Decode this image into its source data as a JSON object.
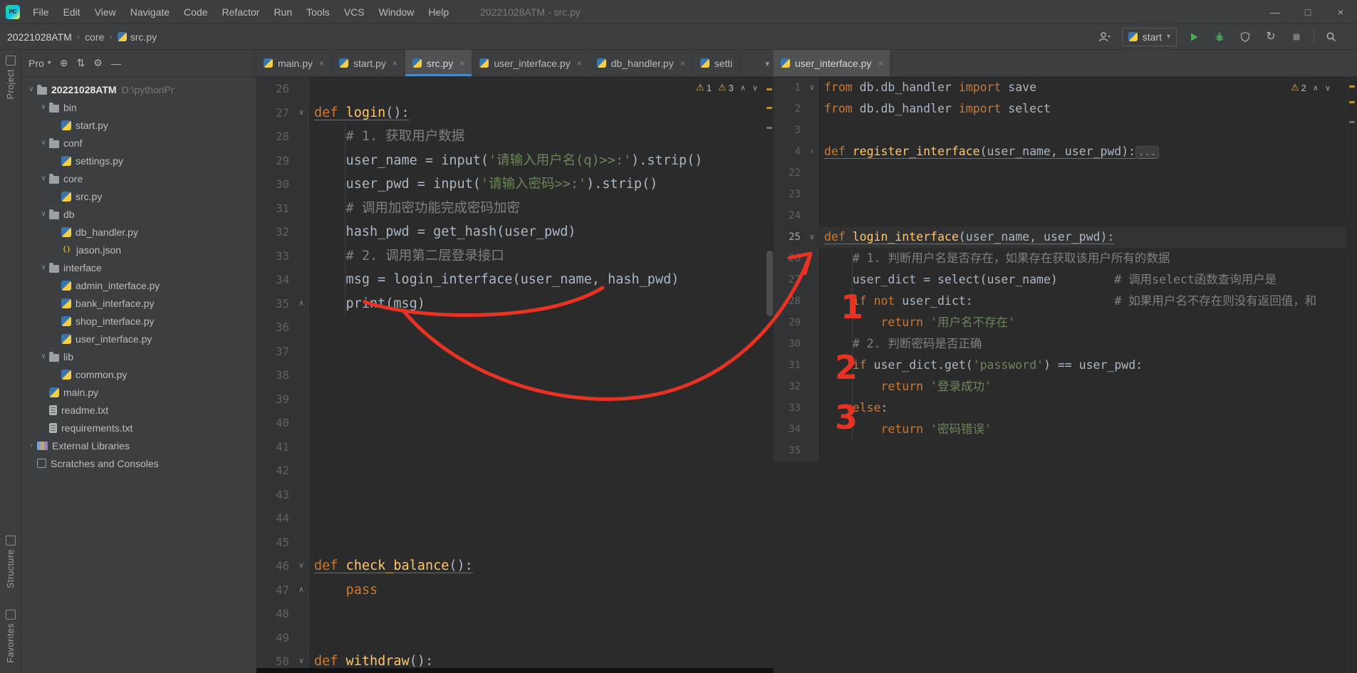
{
  "icons": {
    "close": "×",
    "chevron_down": "▾",
    "breadcrumb_sep": "›",
    "warning": "⚠",
    "collapse": "∧",
    "expand": "∨",
    "minimize": "—",
    "maximize": "□",
    "close_window": "×",
    "locate": "⊕",
    "swap": "⇅",
    "gear": "⚙",
    "hide": "—",
    "restart": "↻",
    "json_braces": "{}",
    "fold_open": "∨",
    "fold_end": "∧",
    "fold_closed": "›"
  },
  "title_bar": {
    "title": "20221028ATM - src.py",
    "menu": [
      "File",
      "Edit",
      "View",
      "Navigate",
      "Code",
      "Refactor",
      "Run",
      "Tools",
      "VCS",
      "Window",
      "Help"
    ]
  },
  "toolbar": {
    "breadcrumbs": [
      "20221028ATM",
      "core",
      "src.py"
    ],
    "run_config": "start"
  },
  "left_stripe": {
    "top": "Project",
    "bottom": [
      "Structure",
      "Favorites"
    ]
  },
  "project_panel": {
    "title": "Pro",
    "tree": [
      {
        "label": "20221028ATM",
        "suffix": "D:\\pythonPr",
        "type": "root",
        "level": 0,
        "chev": "v",
        "bold": true
      },
      {
        "label": "bin",
        "type": "folder",
        "level": 1,
        "chev": "v"
      },
      {
        "label": "start.py",
        "type": "py",
        "level": 2
      },
      {
        "label": "conf",
        "type": "folder",
        "level": 1,
        "chev": "v"
      },
      {
        "label": "settings.py",
        "type": "py",
        "level": 2
      },
      {
        "label": "core",
        "type": "folder",
        "level": 1,
        "chev": "v"
      },
      {
        "label": "src.py",
        "type": "py",
        "level": 2
      },
      {
        "label": "db",
        "type": "folder",
        "level": 1,
        "chev": "v"
      },
      {
        "label": "db_handler.py",
        "type": "py",
        "level": 2
      },
      {
        "label": "jason.json",
        "type": "json",
        "level": 2
      },
      {
        "label": "interface",
        "type": "folder",
        "level": 1,
        "chev": "v"
      },
      {
        "label": "admin_interface.py",
        "type": "py",
        "level": 2
      },
      {
        "label": "bank_interface.py",
        "type": "py",
        "level": 2
      },
      {
        "label": "shop_interface.py",
        "type": "py",
        "level": 2
      },
      {
        "label": "user_interface.py",
        "type": "py",
        "level": 2
      },
      {
        "label": "lib",
        "type": "folder",
        "level": 1,
        "chev": "v"
      },
      {
        "label": "common.py",
        "type": "py",
        "level": 2
      },
      {
        "label": "main.py",
        "type": "py",
        "level": 1
      },
      {
        "label": "readme.txt",
        "type": "txt",
        "level": 1
      },
      {
        "label": "requirements.txt",
        "type": "txt",
        "level": 1
      },
      {
        "label": "External Libraries",
        "type": "ext",
        "level": 0,
        "chev": ">"
      },
      {
        "label": "Scratches and Consoles",
        "type": "scratch",
        "level": 0
      }
    ]
  },
  "tabs": {
    "left": [
      {
        "label": "main.py"
      },
      {
        "label": "start.py"
      },
      {
        "label": "src.py",
        "active": "blue"
      },
      {
        "label": "user_interface.py"
      },
      {
        "label": "db_handler.py"
      },
      {
        "label": "setti",
        "close": false
      }
    ],
    "right": [
      {
        "label": "user_interface.py",
        "active": "gray"
      }
    ]
  },
  "editor_left": {
    "warnings": [
      "1",
      "3"
    ],
    "lines": [
      {
        "n": 26
      },
      {
        "n": 27,
        "f": "∨",
        "u": true,
        "t": [
          [
            "kw",
            "def"
          ],
          [
            "fn",
            " login"
          ],
          [
            "pl",
            "():"
          ]
        ]
      },
      {
        "n": 28,
        "t": [
          [
            "cm",
            "    # 1. 获取用户数据"
          ]
        ]
      },
      {
        "n": 29,
        "t": [
          [
            "pl",
            "    user_name = input("
          ],
          [
            "st",
            "'请输入用户名(q)>>:'"
          ],
          [
            "pl",
            ").strip()"
          ]
        ]
      },
      {
        "n": 30,
        "t": [
          [
            "pl",
            "    user_pwd = input("
          ],
          [
            "st",
            "'请输入密码>>:'"
          ],
          [
            "pl",
            ").strip()"
          ]
        ]
      },
      {
        "n": 31,
        "t": [
          [
            "cm",
            "    # 调用加密功能完成密码加密"
          ]
        ]
      },
      {
        "n": 32,
        "t": [
          [
            "pl",
            "    hash_pwd = get_hash(user_pwd)"
          ]
        ]
      },
      {
        "n": 33,
        "t": [
          [
            "cm",
            "    # 2. 调用第二层登录接口"
          ]
        ]
      },
      {
        "n": 34,
        "t": [
          [
            "pl",
            "    msg = login_interface(user_name, hash_pwd)"
          ]
        ]
      },
      {
        "n": 35,
        "f": "∧",
        "t": [
          [
            "pl",
            "    print(msg)"
          ]
        ]
      },
      {
        "n": 36
      },
      {
        "n": 37
      },
      {
        "n": 38
      },
      {
        "n": 39
      },
      {
        "n": 40
      },
      {
        "n": 41
      },
      {
        "n": 42
      },
      {
        "n": 43
      },
      {
        "n": 44
      },
      {
        "n": 45
      },
      {
        "n": 46,
        "f": "∨",
        "u": true,
        "t": [
          [
            "kw",
            "def"
          ],
          [
            "fn",
            " check_balance"
          ],
          [
            "pl",
            "():"
          ]
        ]
      },
      {
        "n": 47,
        "f": "∧",
        "t": [
          [
            "kw",
            "    pass"
          ]
        ]
      },
      {
        "n": 48
      },
      {
        "n": 49
      },
      {
        "n": 50,
        "f": "∨",
        "u": true,
        "t": [
          [
            "kw",
            "def"
          ],
          [
            "fn",
            " withdraw"
          ],
          [
            "pl",
            "():"
          ]
        ]
      }
    ]
  },
  "editor_right": {
    "warnings": [
      "2"
    ],
    "lines": [
      {
        "n": 1,
        "f": "∨",
        "t": [
          [
            "kw",
            "from"
          ],
          [
            "pl",
            " db.db_handler "
          ],
          [
            "kw",
            "import"
          ],
          [
            "pl",
            " save"
          ]
        ]
      },
      {
        "n": 2,
        "t": [
          [
            "kw",
            "from"
          ],
          [
            "pl",
            " db.db_handler "
          ],
          [
            "kw",
            "import"
          ],
          [
            "pl",
            " select"
          ]
        ]
      },
      {
        "n": 3
      },
      {
        "n": 4,
        "f": "›",
        "u": true,
        "t": [
          [
            "kw",
            "def"
          ],
          [
            "fn",
            " register_interface"
          ],
          [
            "pl",
            "(user_name, user_pwd):"
          ],
          [
            "fd",
            "..."
          ]
        ]
      },
      {
        "n": 22
      },
      {
        "n": 23
      },
      {
        "n": 24
      },
      {
        "n": 25,
        "f": "∨",
        "u": true,
        "h": true,
        "t": [
          [
            "kw",
            "def"
          ],
          [
            "fn",
            " login_interface"
          ],
          [
            "pl",
            "(user_name, user_pwd):"
          ]
        ]
      },
      {
        "n": 26,
        "t": [
          [
            "cm",
            "    # 1. 判断用户名是否存在，如果存在获取该用户所有的数据"
          ]
        ]
      },
      {
        "n": 27,
        "t": [
          [
            "pl",
            "    user_dict = select(user_name)        "
          ],
          [
            "cm",
            "# 调用select函数查询用户是"
          ]
        ]
      },
      {
        "n": 28,
        "t": [
          [
            "pl",
            "    "
          ],
          [
            "kw",
            "if"
          ],
          [
            "pl",
            " "
          ],
          [
            "kw",
            "not"
          ],
          [
            "pl",
            " user_dict:                    "
          ],
          [
            "cm",
            "# 如果用户名不存在则没有返回值，和"
          ]
        ]
      },
      {
        "n": 29,
        "t": [
          [
            "pl",
            "        "
          ],
          [
            "kw",
            "return"
          ],
          [
            "pl",
            " "
          ],
          [
            "st",
            "'用户名不存在'"
          ]
        ]
      },
      {
        "n": 30,
        "t": [
          [
            "cm",
            "    # 2. 判断密码是否正确"
          ]
        ]
      },
      {
        "n": 31,
        "t": [
          [
            "pl",
            "    "
          ],
          [
            "kw",
            "if"
          ],
          [
            "pl",
            " user_dict.get("
          ],
          [
            "st",
            "'password'"
          ],
          [
            "pl",
            ") == user_pwd:"
          ]
        ]
      },
      {
        "n": 32,
        "t": [
          [
            "pl",
            "        "
          ],
          [
            "kw",
            "return"
          ],
          [
            "pl",
            " "
          ],
          [
            "st",
            "'登录成功'"
          ]
        ]
      },
      {
        "n": 33,
        "t": [
          [
            "pl",
            "    "
          ],
          [
            "kw",
            "else"
          ],
          [
            "pl",
            ":"
          ]
        ]
      },
      {
        "n": 34,
        "t": [
          [
            "pl",
            "        "
          ],
          [
            "kw",
            "return"
          ],
          [
            "pl",
            " "
          ],
          [
            "st",
            "'密码错误'"
          ]
        ]
      },
      {
        "n": 35
      }
    ]
  },
  "annotations": {
    "color": "#e73224",
    "labels": [
      "1",
      "2",
      "3"
    ]
  }
}
